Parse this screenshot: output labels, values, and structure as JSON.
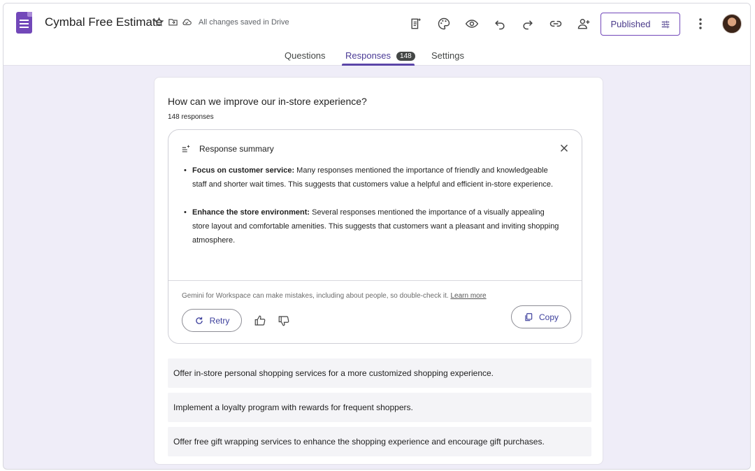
{
  "header": {
    "title": "Cymbal Free Estimate",
    "saved_status": "All changes saved in Drive",
    "publish_label": "Published"
  },
  "tabs": [
    {
      "label": "Questions"
    },
    {
      "label": "Responses",
      "badge": "148"
    },
    {
      "label": "Settings"
    }
  ],
  "question": {
    "title": "How can we improve our in-store experience?",
    "response_count": "148 responses"
  },
  "summary": {
    "heading": "Response summary",
    "bullets": [
      {
        "bold": "Focus on customer service:",
        "text": " Many responses mentioned the importance of friendly and knowledgeable staff and shorter wait times. This suggests that customers value a helpful and efficient in-store experience."
      },
      {
        "bold": "Enhance the store environment:",
        "text": " Several responses mentioned the importance of a visually appealing store layout and comfortable amenities. This suggests that customers want a pleasant and inviting shopping atmosphere."
      }
    ],
    "disclaimer": "Gemini for Workspace can make mistakes, including about people, so double-check it.",
    "learn_more": "Learn more",
    "retry_label": "Retry",
    "copy_label": "Copy"
  },
  "responses": [
    "Offer in-store personal shopping services for a more customized shopping experience.",
    "Implement a loyalty program with rewards for frequent shoppers.",
    "Offer free gift wrapping services to enhance the shopping experience and encourage gift purchases."
  ],
  "colors": {
    "accent": "#7248b9",
    "tab_active": "#4b3b96",
    "button_text": "#3c3f9c",
    "background": "#efedf8"
  }
}
